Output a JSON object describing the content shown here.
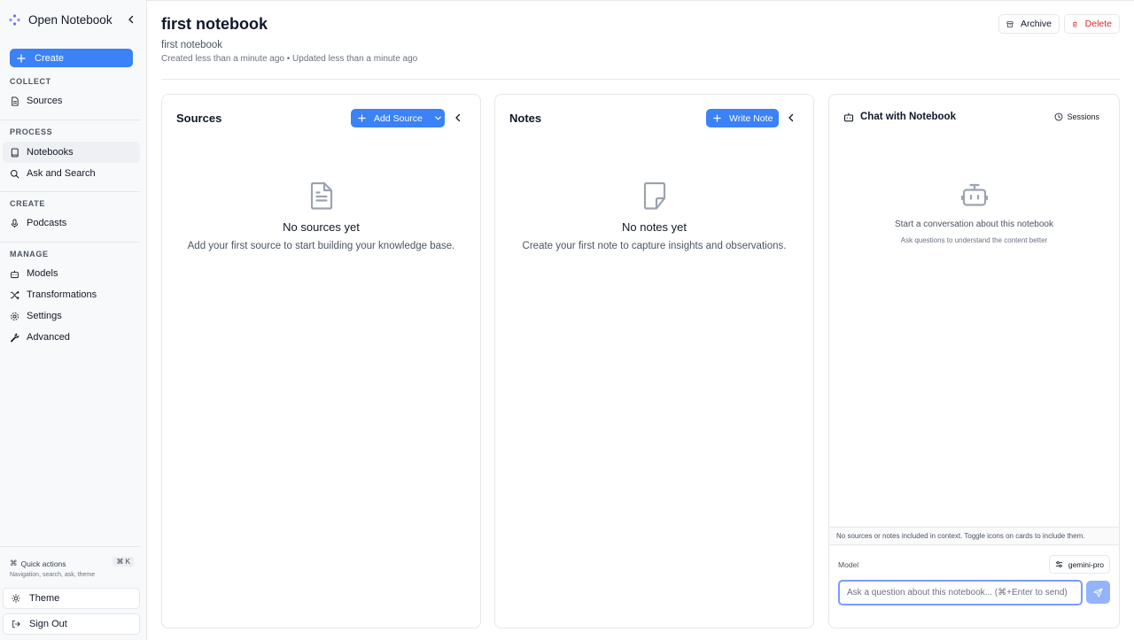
{
  "app": {
    "name": "Open Notebook"
  },
  "sidebar": {
    "create_label": "Create",
    "sections": {
      "collect": "COLLECT",
      "process": "PROCESS",
      "create": "CREATE",
      "manage": "MANAGE"
    },
    "items": {
      "sources": "Sources",
      "notebooks": "Notebooks",
      "ask_search": "Ask and Search",
      "podcasts": "Podcasts",
      "models": "Models",
      "transformations": "Transformations",
      "settings": "Settings",
      "advanced": "Advanced"
    },
    "active_item": "Notebooks",
    "quick_actions": {
      "label": "Quick actions",
      "shortcut": "⌘ K",
      "hint": "Navigation, search, ask, theme"
    },
    "theme_label": "Theme",
    "signout_label": "Sign Out"
  },
  "notebook": {
    "title": "first notebook",
    "description": "first notebook",
    "meta": "Created less than a minute ago • Updated less than a minute ago",
    "archive_label": "Archive",
    "delete_label": "Delete"
  },
  "sources_panel": {
    "title": "Sources",
    "add_label": "Add Source",
    "empty_title": "No sources yet",
    "empty_sub": "Add your first source to start building your knowledge base."
  },
  "notes_panel": {
    "title": "Notes",
    "write_label": "Write Note",
    "empty_title": "No notes yet",
    "empty_sub": "Create your first note to capture insights and observations."
  },
  "chat_panel": {
    "title": "Chat with Notebook",
    "sessions_label": "Sessions",
    "empty_title": "Start a conversation about this notebook",
    "empty_sub": "Ask questions to understand the content better",
    "context_notice": "No sources or notes included in context. Toggle icons on cards to include them.",
    "model_label": "Model",
    "model_value": "gemini-pro",
    "input_placeholder": "Ask a question about this notebook... (⌘+Enter to send)"
  },
  "colors": {
    "accent": "#3b82f6",
    "delete": "#dc2626",
    "sidebar_bg": "#f8f9fa"
  }
}
